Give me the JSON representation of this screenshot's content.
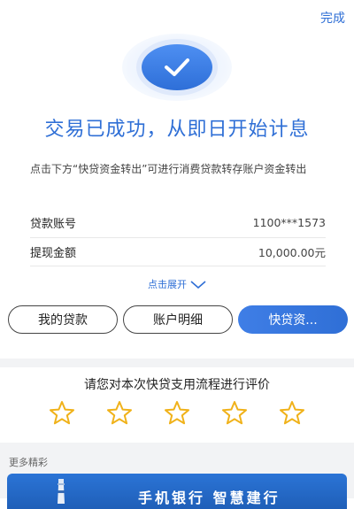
{
  "header": {
    "done_label": "完成"
  },
  "result": {
    "headline": "交易已成功，从即日开始计息"
  },
  "tip": "点击下方“快贷资金转出”可进行消费贷款转存账户资金转出",
  "details": [
    {
      "label": "贷款账号",
      "value": "1100***1573"
    },
    {
      "label": "提现金额",
      "value": "10,000.00元"
    }
  ],
  "expand_label": "点击展开",
  "actions": {
    "my_loans": "我的贷款",
    "account_detail": "账户明细",
    "quick_loan": "快贷资..."
  },
  "rating": {
    "title": "请您对本次快贷支用流程进行评价",
    "stars": 5,
    "selected": 0
  },
  "more": {
    "title": "更多精彩",
    "banner_text": "手机银行  智慧建行"
  },
  "colors": {
    "accent": "#2f6fd6",
    "star": "#f0b21a",
    "band": "#f2f3f5"
  }
}
